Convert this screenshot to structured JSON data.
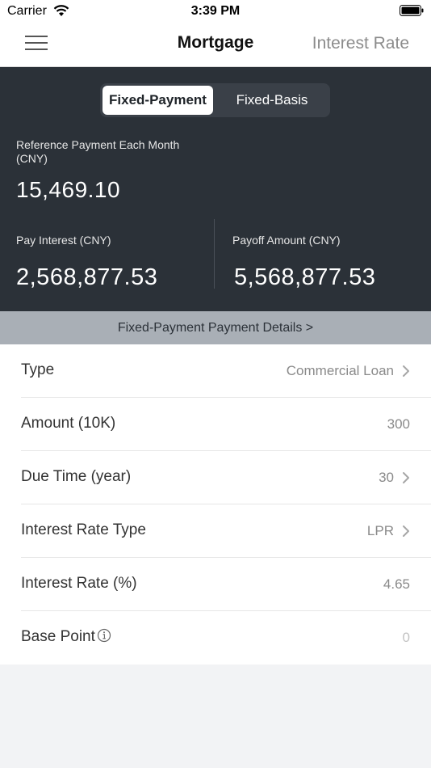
{
  "status_bar": {
    "carrier": "Carrier",
    "time": "3:39 PM"
  },
  "nav": {
    "title": "Mortgage",
    "right_label": "Interest Rate"
  },
  "segments": {
    "active": "Fixed-Payment",
    "inactive": "Fixed-Basis"
  },
  "summary": {
    "ref_label": "Reference Payment Each Month (CNY)",
    "ref_value": "15,469.10",
    "interest_label": "Pay Interest (CNY)",
    "interest_value": "2,568,877.53",
    "payoff_label": "Payoff Amount (CNY)",
    "payoff_value": "5,568,877.53"
  },
  "details_link": "Fixed-Payment Payment Details >",
  "form": {
    "type_label": "Type",
    "type_value": "Commercial Loan",
    "amount_label": "Amount (10K)",
    "amount_value": "300",
    "due_label": "Due Time (year)",
    "due_value": "30",
    "rate_type_label": "Interest Rate Type",
    "rate_type_value": "LPR",
    "rate_label": "Interest Rate (%)",
    "rate_value": "4.65",
    "base_label": "Base Point",
    "base_value": "0"
  },
  "icons": {
    "menu": "hamburger-menu-icon",
    "chevron": "chevron-right-icon",
    "info": "info-circle-icon"
  },
  "colors": {
    "header_dark": "#2b3138",
    "details_bar": "#a9afb6",
    "background": "#f2f3f5"
  }
}
